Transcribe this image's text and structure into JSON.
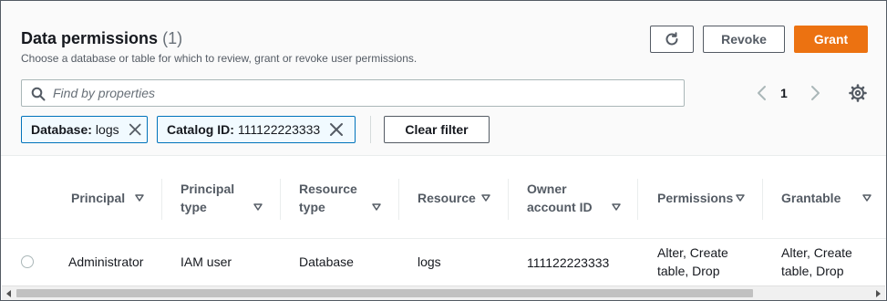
{
  "header": {
    "title": "Data permissions",
    "count": "(1)",
    "subtitle": "Choose a database or table for which to review, grant or revoke user permissions."
  },
  "actions": {
    "refresh_icon": "refresh-icon",
    "revoke_label": "Revoke",
    "grant_label": "Grant",
    "grant_color": "#ec7211"
  },
  "search": {
    "placeholder": "Find by properties",
    "value": "",
    "icon": "search-icon"
  },
  "pagination": {
    "current_page": "1",
    "prev_icon": "chevron-left-icon",
    "next_icon": "chevron-right-icon",
    "settings_icon": "gear-icon"
  },
  "filters": {
    "tokens": [
      {
        "key": "Database:",
        "value": "logs"
      },
      {
        "key": "Catalog ID:",
        "value": "111122223333"
      }
    ],
    "clear_label": "Clear filter",
    "token_border_color": "#0073bb"
  },
  "table": {
    "columns": [
      {
        "line1": "Principal",
        "line2": ""
      },
      {
        "line1": "Principal",
        "line2": "type"
      },
      {
        "line1": "Resource",
        "line2": "type"
      },
      {
        "line1": "Resource",
        "line2": ""
      },
      {
        "line1": "Owner",
        "line2": "account ID"
      },
      {
        "line1": "Permissions",
        "line2": ""
      },
      {
        "line1": "Grantable",
        "line2": ""
      }
    ],
    "rows": [
      {
        "principal": "Administrator",
        "principal_type": "IAM user",
        "resource_type": "Database",
        "resource": "logs",
        "owner_account_id": "111122223333",
        "permissions_line1": "Alter, Create",
        "permissions_line2": "table, Drop",
        "grantable_line1": "Alter, Create",
        "grantable_line2": "table, Drop"
      }
    ]
  }
}
